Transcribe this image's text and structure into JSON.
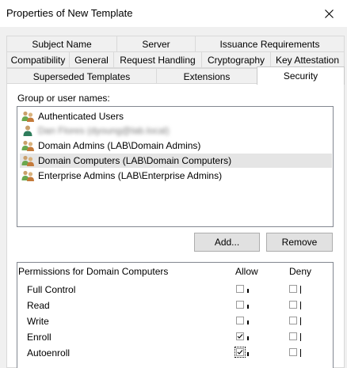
{
  "window": {
    "title": "Properties of New Template",
    "close_icon": "close-icon"
  },
  "tabs": {
    "row1": [
      "Subject Name",
      "Server",
      "Issuance Requirements"
    ],
    "row2": [
      "Compatibility",
      "General",
      "Request Handling",
      "Cryptography",
      "Key Attestation"
    ],
    "row3": [
      "Superseded Templates",
      "Extensions",
      "Security"
    ],
    "active": "Security"
  },
  "security": {
    "group_label": "Group or user names:",
    "principals": [
      {
        "name": "Authenticated Users",
        "icon": "group-icon",
        "selected": false,
        "redacted": false
      },
      {
        "name": "Dan Flores (dyoung@lab.local)",
        "icon": "user-icon",
        "selected": false,
        "redacted": true
      },
      {
        "name": "Domain Admins (LAB\\Domain Admins)",
        "icon": "group-icon",
        "selected": false,
        "redacted": false
      },
      {
        "name": "Domain Computers (LAB\\Domain Computers)",
        "icon": "group-icon",
        "selected": true,
        "redacted": false
      },
      {
        "name": "Enterprise Admins (LAB\\Enterprise Admins)",
        "icon": "group-icon",
        "selected": false,
        "redacted": false
      }
    ],
    "add_button": "Add...",
    "remove_button": "Remove",
    "permissions_label": "Permissions for Domain Computers",
    "allow_header": "Allow",
    "deny_header": "Deny",
    "permissions": [
      {
        "name": "Full Control",
        "allow": false,
        "deny": false
      },
      {
        "name": "Read",
        "allow": false,
        "deny": false
      },
      {
        "name": "Write",
        "allow": false,
        "deny": false
      },
      {
        "name": "Enroll",
        "allow": true,
        "deny": false
      },
      {
        "name": "Autoenroll",
        "allow": true,
        "deny": false
      }
    ]
  },
  "colors": {
    "selected_row": "#e5e5e5",
    "group_icon_green": "#6aa84f",
    "group_icon_brown": "#c47a3a"
  }
}
